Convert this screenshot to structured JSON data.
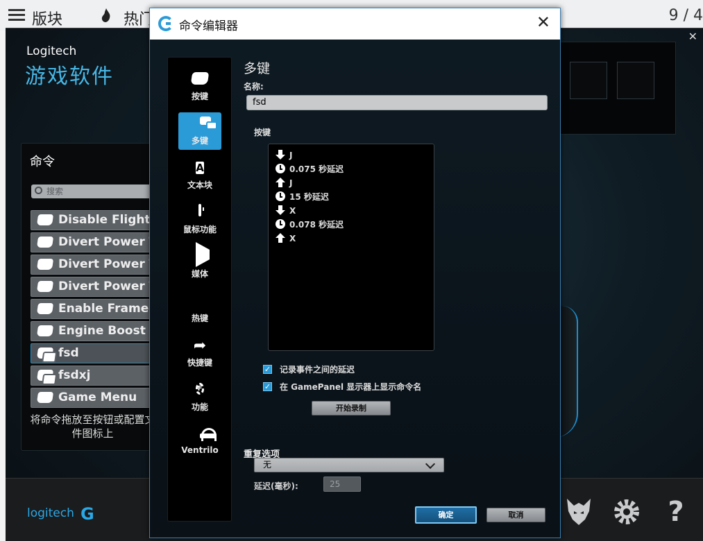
{
  "browser": {
    "tab_blocks": "版块",
    "tab_hot": "热门",
    "page_counter": "9 / 4"
  },
  "lgs": {
    "brand": "Logitech",
    "app_title": "游戏软件",
    "commands_title": "命令",
    "search_placeholder": "搜索",
    "commands": [
      {
        "label": "Disable Flight Assist",
        "icon": "key-icon"
      },
      {
        "label": "Divert Power To Engines",
        "icon": "key-icon"
      },
      {
        "label": "Divert Power To Systems",
        "icon": "key-icon"
      },
      {
        "label": "Divert Power To Weapons",
        "icon": "key-icon"
      },
      {
        "label": "Enable Frame Shift Drive",
        "icon": "key-icon"
      },
      {
        "label": "Engine Boost",
        "icon": "key-icon"
      },
      {
        "label": "fsd",
        "icon": "multikey-icon",
        "selected": true
      },
      {
        "label": "fsdxj",
        "icon": "multikey-icon"
      },
      {
        "label": "Game Menu",
        "icon": "key-icon"
      }
    ],
    "drag_hint": "将命令拖放至按钮或配置文件图标上",
    "bottom_brand": "logitech",
    "bottom_brand_g": "G",
    "bottom_icons": [
      "wolf-icon",
      "gear-icon",
      "help-icon"
    ],
    "help_glyph": "?"
  },
  "dialog": {
    "title": "命令编辑器",
    "close_glyph": "✕",
    "categories": [
      {
        "label": "按键",
        "icon": "key-icon"
      },
      {
        "label": "多键",
        "icon": "multikey-icon",
        "selected": true
      },
      {
        "label": "文本块",
        "icon": "text-block-icon",
        "glyph": "A"
      },
      {
        "label": "鼠标功能",
        "icon": "mouse-icon"
      },
      {
        "label": "媒体",
        "icon": "media-play-icon"
      },
      {
        "label": "热键",
        "icon": "hotkey-icon"
      },
      {
        "label": "快捷键",
        "icon": "shortcut-arrow-icon",
        "glyph": "➦"
      },
      {
        "label": "功能",
        "icon": "function-gear-icon",
        "glyph": "F"
      },
      {
        "label": "Ventrilo",
        "icon": "headset-icon"
      }
    ],
    "section_title": "多键",
    "name_label": "名称:",
    "name_value": "fsd",
    "keys_label": "按键",
    "key_events": [
      {
        "type": "down",
        "text": "J"
      },
      {
        "type": "delay",
        "text": "0.075 秒延迟"
      },
      {
        "type": "up",
        "text": "J"
      },
      {
        "type": "delay",
        "text": "15 秒延迟"
      },
      {
        "type": "down",
        "text": "X"
      },
      {
        "type": "delay",
        "text": "0.078 秒延迟"
      },
      {
        "type": "up",
        "text": "X"
      }
    ],
    "record_delays_label": "记录事件之间的延迟",
    "record_delays_checked": true,
    "show_on_gamepanel_label": "在 GamePanel 显示器上显示命令名",
    "show_on_gamepanel_checked": true,
    "checkmark": "✓",
    "start_record": "开始录制",
    "repeat_label": "重复选项",
    "repeat_value": "无",
    "delay_label": "延迟(毫秒):",
    "delay_value": "25",
    "ok": "确定",
    "cancel": "取消"
  }
}
